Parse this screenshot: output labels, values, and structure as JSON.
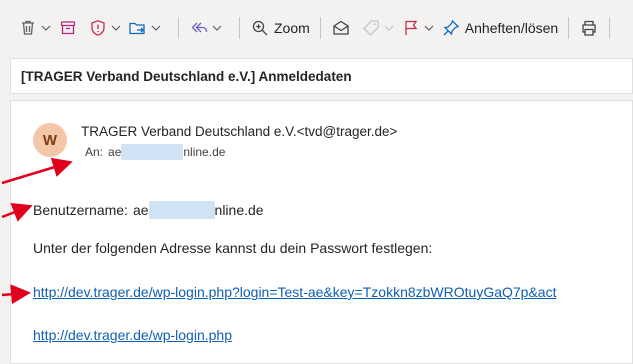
{
  "toolbar": {
    "zoom_label": "Zoom",
    "pin_label": "Anheften/lösen"
  },
  "subject": "[TRAGER Verband Deutschland e.V.] Anmeldedaten",
  "message": {
    "avatar_initial": "W",
    "sender": "TRAGER Verband Deutschland e.V.<tvd@trager.de>",
    "to_label": "An:",
    "to_prefix": "ae",
    "to_suffix": "nline.de",
    "username_label": "Benutzername:",
    "username_prefix": "ae",
    "username_suffix": "nline.de",
    "instruction": "Unter der folgenden Adresse kannst du dein Passwort festlegen:",
    "reset_link": "http://dev.trager.de/wp-login.php?login=Test-ae&key=Tzokkn8zbWROtuyGaQ7p&act",
    "login_link": "http://dev.trager.de/wp-login.php"
  },
  "colors": {
    "link": "#0f5fb3",
    "annotation_arrow": "#e0001b",
    "redaction": "#cfe3f5",
    "avatar_bg": "#f4c7a8"
  }
}
